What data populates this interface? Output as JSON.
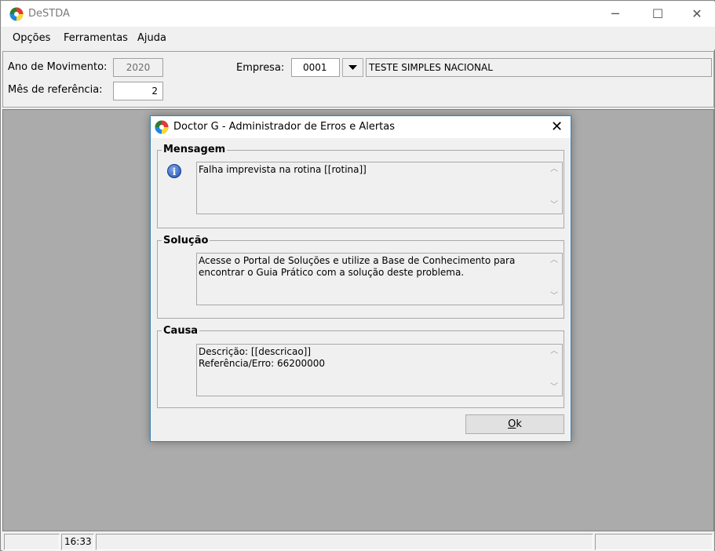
{
  "app": {
    "title": "DeSTDA"
  },
  "window_controls": {
    "minimize": "─",
    "maximize": "☐",
    "close": "✕"
  },
  "menu": [
    "Opções",
    "Ferramentas",
    "Ajuda"
  ],
  "params": {
    "ano_label": "Ano de Movimento:",
    "ano_value": "2020",
    "mes_label": "Mês de referência:",
    "mes_value": "2",
    "empresa_label": "Empresa:",
    "empresa_code": "0001",
    "empresa_name": "TESTE SIMPLES NACIONAL"
  },
  "dialog": {
    "title": "Doctor G - Administrador de Erros e Alertas",
    "close": "✕",
    "mensagem": {
      "legend": "Mensagem",
      "text": "Falha imprevista na rotina [[rotina]]"
    },
    "solucao": {
      "legend": "Solução",
      "text": "Acesse o Portal de Soluções e utilize a Base de Conhecimento para encontrar o Guia Prático com a solução deste problema."
    },
    "causa": {
      "legend": "Causa",
      "text": "Descrição: [[descricao]]\nReferência/Erro: 66200000"
    },
    "ok_label_underlined": "O",
    "ok_label_rest": "k"
  },
  "status": {
    "time": "16:33"
  },
  "icons": {
    "app": "app-logo-icon",
    "info": "info-icon",
    "dropdown": "dropdown-arrow-icon"
  }
}
